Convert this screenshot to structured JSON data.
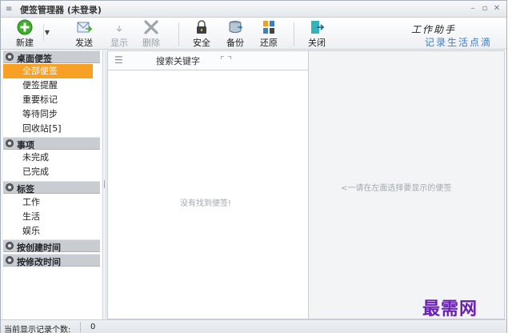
{
  "window": {
    "title": "便签管理器 (未登录)"
  },
  "toolbar": {
    "new_label": "新建",
    "send_label": "发送",
    "show_label": "显示",
    "delete_label": "删除",
    "security_label": "安全",
    "backup_label": "备份",
    "restore_label": "还原",
    "close_label": "关闭"
  },
  "brand": {
    "line1": "工作助手",
    "line2": "记录生活点滴"
  },
  "sidebar": {
    "groups": [
      {
        "label": "桌面便签",
        "items": [
          {
            "label": "全部便签",
            "selected": true
          },
          {
            "label": "便签提醒"
          },
          {
            "label": "重要标记"
          },
          {
            "label": "等待同步"
          },
          {
            "label": "回收站[5]"
          }
        ]
      },
      {
        "label": "事项",
        "items": [
          {
            "label": "未完成"
          },
          {
            "label": "已完成"
          }
        ]
      },
      {
        "label": "标签",
        "items": [
          {
            "label": "工作"
          },
          {
            "label": "生活"
          },
          {
            "label": "娱乐"
          }
        ]
      },
      {
        "label": "按创建时间",
        "items": []
      },
      {
        "label": "按修改时间",
        "items": []
      }
    ]
  },
  "list": {
    "search_placeholder": "搜索关键字",
    "empty_text": "没有找到便签!"
  },
  "detail": {
    "hint": "<一请在左面选择要显示的便签"
  },
  "status": {
    "label": "当前显示记录个数:",
    "count": "0"
  },
  "watermark": "最需网",
  "colors": {
    "selected_bg": "#f7a023",
    "brand_blue": "#3b7fc4",
    "watermark": "#6a1fb5"
  },
  "icons": {
    "new": "plus-circle-icon",
    "send": "send-icon",
    "show": "show-icon",
    "delete": "delete-x-icon",
    "security": "lock-icon",
    "backup": "backup-icon",
    "restore": "restore-icon",
    "close": "close-door-icon",
    "search": "search-icon",
    "menu": "list-menu-icon"
  }
}
